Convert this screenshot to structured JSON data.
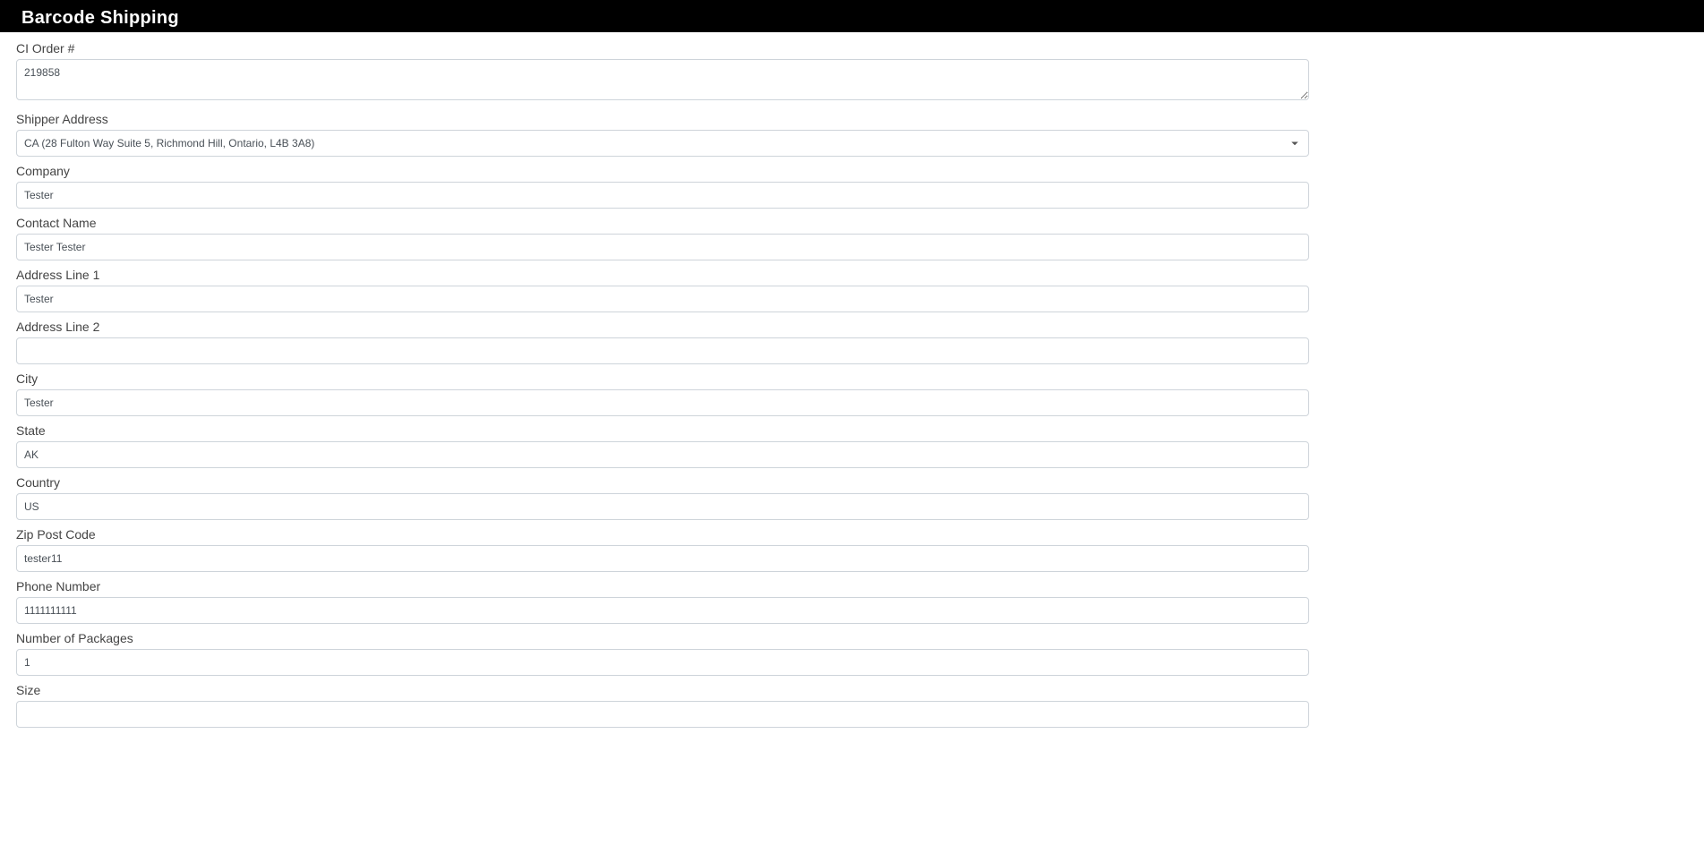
{
  "header": {
    "title": "Barcode Shipping"
  },
  "form": {
    "ci_order": {
      "label": "CI Order #",
      "value": "219858"
    },
    "shipper_address": {
      "label": "Shipper Address",
      "value": "CA (28 Fulton Way Suite 5, Richmond Hill, Ontario, L4B 3A8)"
    },
    "company": {
      "label": "Company",
      "value": "Tester"
    },
    "contact_name": {
      "label": "Contact Name",
      "value": "Tester Tester"
    },
    "address_line_1": {
      "label": "Address Line 1",
      "value": "Tester"
    },
    "address_line_2": {
      "label": "Address Line 2",
      "value": ""
    },
    "city": {
      "label": "City",
      "value": "Tester"
    },
    "state": {
      "label": "State",
      "value": "AK"
    },
    "country": {
      "label": "Country",
      "value": "US"
    },
    "zip": {
      "label": "Zip Post Code",
      "value": "tester11"
    },
    "phone": {
      "label": "Phone Number",
      "value": "1111111111"
    },
    "num_packages": {
      "label": "Number of Packages",
      "value": "1"
    },
    "size": {
      "label": "Size",
      "value": ""
    }
  }
}
